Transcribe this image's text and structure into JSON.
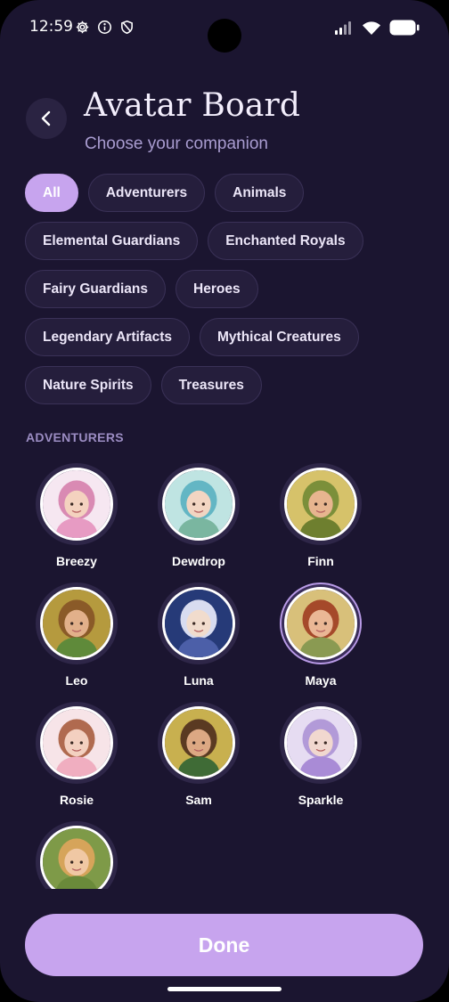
{
  "status": {
    "time": "12:59",
    "icons": [
      "gear-icon",
      "info-icon",
      "shield-icon"
    ],
    "right_icons": [
      "signal-icon",
      "wifi-icon",
      "battery-icon"
    ]
  },
  "header": {
    "title": "Avatar Board",
    "subtitle": "Choose your companion"
  },
  "categories": {
    "selected": "All",
    "rows": [
      [
        "All",
        "Adventurers",
        "Animals"
      ],
      [
        "Elemental Guardians",
        "Enchanted Royals"
      ],
      [
        "Fairy Guardians",
        "Heroes"
      ],
      [
        "Legendary Artifacts",
        "Mythical Creatures"
      ],
      [
        "Nature Spirits",
        "Treasures"
      ]
    ]
  },
  "section": {
    "title": "ADVENTURERS"
  },
  "avatars": [
    {
      "name": "Breezy",
      "bg": "#f6e7f1",
      "hair": "#d98ab3",
      "skin": "#f4d2bf",
      "outfit": "#e79bc3"
    },
    {
      "name": "Dewdrop",
      "bg": "#bfe4e2",
      "hair": "#63b6c4",
      "skin": "#f2d5c2",
      "outfit": "#7ab6a0"
    },
    {
      "name": "Finn",
      "bg": "#d6c26a",
      "hair": "#7b8f3a",
      "skin": "#e7b58f",
      "outfit": "#6e7f2f"
    },
    {
      "name": "Leo",
      "bg": "#b59a3e",
      "hair": "#8a5a28",
      "skin": "#e2b08a",
      "outfit": "#5f8a3a"
    },
    {
      "name": "Luna",
      "bg": "#263a78",
      "hair": "#d8dcf0",
      "skin": "#f1dccd",
      "outfit": "#4c5fa8"
    },
    {
      "name": "Maya",
      "bg": "#d8c07a",
      "hair": "#a5492a",
      "skin": "#eab795",
      "outfit": "#8a9a52"
    },
    {
      "name": "Rosie",
      "bg": "#f7e4e8",
      "hair": "#b06a4f",
      "skin": "#f3d0c0",
      "outfit": "#f0aec0"
    },
    {
      "name": "Sam",
      "bg": "#c8b04f",
      "hair": "#5a3a22",
      "skin": "#dca883",
      "outfit": "#3f6b36"
    },
    {
      "name": "Sparkle",
      "bg": "#e6dcf2",
      "hair": "#b29ad8",
      "skin": "#f1d8cf",
      "outfit": "#a98bd6"
    },
    {
      "name": "",
      "bg": "#7e9a48",
      "hair": "#d6a45a",
      "skin": "#f0c8a4",
      "outfit": "#6a8a3a"
    }
  ],
  "selected_avatar": "Maya",
  "actions": {
    "done_label": "Done"
  }
}
